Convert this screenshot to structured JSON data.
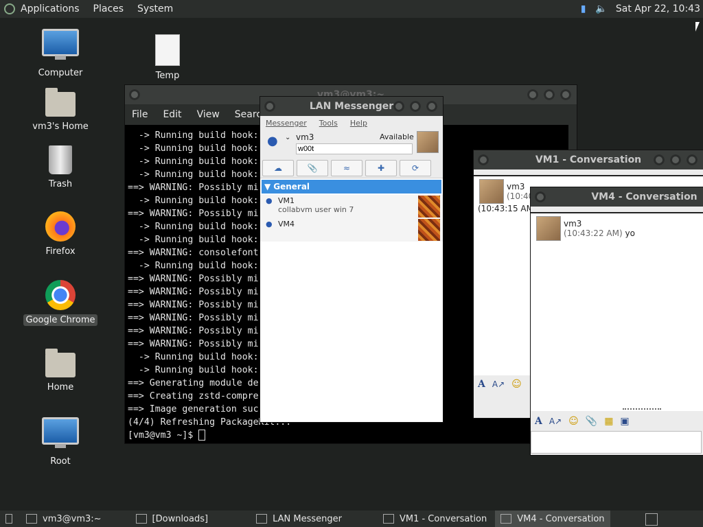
{
  "top_panel": {
    "menus": [
      "Applications",
      "Places",
      "System"
    ],
    "clock": "Sat Apr 22, 10:43"
  },
  "desktop_icons": [
    {
      "label": "Computer",
      "icon": "computer-icon"
    },
    {
      "label": "Temp",
      "icon": "document-icon"
    },
    {
      "label": "vm3's Home",
      "icon": "home-folder-icon"
    },
    {
      "label": "Trash",
      "icon": "trash-icon"
    },
    {
      "label": "Firefox",
      "icon": "firefox-icon"
    },
    {
      "label": "Google Chrome",
      "icon": "chrome-icon"
    },
    {
      "label": "Home",
      "icon": "home-folder-icon"
    },
    {
      "label": "Root",
      "icon": "computer-icon"
    }
  ],
  "terminal": {
    "title": "vm3@vm3:~",
    "menu": [
      "File",
      "Edit",
      "View",
      "Search"
    ],
    "lines": [
      "  -> Running build hook:",
      "  -> Running build hook:",
      "  -> Running build hook:",
      "  -> Running build hook:",
      "==> WARNING: Possibly mi",
      "  -> Running build hook:",
      "==> WARNING: Possibly mi                             ci",
      "  -> Running build hook:",
      "  -> Running build hook:",
      "==> WARNING: consolefont",
      "  -> Running build hook:",
      "==> WARNING: Possibly mi                            k",
      "==> WARNING: Possibly mi                            b",
      "==> WARNING: Possibly mi",
      "==> WARNING: Possibly mi",
      "==> WARNING: Possibly mi",
      "==> WARNING: Possibly mi                            k",
      "  -> Running build hook:",
      "  -> Running build hook:",
      "==> Generating module de",
      "==> Creating zstd-compre                            nfs-li",
      "==> Image generation suc",
      "(4/4) Refreshing PackageKit...",
      "[vm3@vm3 ~]$ "
    ]
  },
  "messenger": {
    "title": "LAN Messenger",
    "menu": [
      "Messenger",
      "Tools",
      "Help"
    ],
    "user_name": "vm3",
    "status": "Available",
    "status_note": "w00t",
    "group": "General",
    "contacts": [
      {
        "name": "VM1",
        "note": "collabvm user win 7"
      },
      {
        "name": "VM4",
        "note": ""
      }
    ]
  },
  "vm1_conversation": {
    "title": "VM1 - Conversation",
    "sender": "vm3",
    "time_partial": "(10:40",
    "time2": "(10:43:15 AM"
  },
  "vm4_conversation": {
    "title": "VM4 - Conversation",
    "sender": "vm3",
    "time": "(10:43:22 AM)",
    "text": "yo"
  },
  "taskbar": [
    {
      "label": "vm3@vm3:~",
      "active": false
    },
    {
      "label": "[Downloads]",
      "active": false
    },
    {
      "label": "LAN Messenger",
      "active": false
    },
    {
      "label": "VM1 - Conversation",
      "active": false
    },
    {
      "label": "VM4 - Conversation",
      "active": true
    }
  ]
}
